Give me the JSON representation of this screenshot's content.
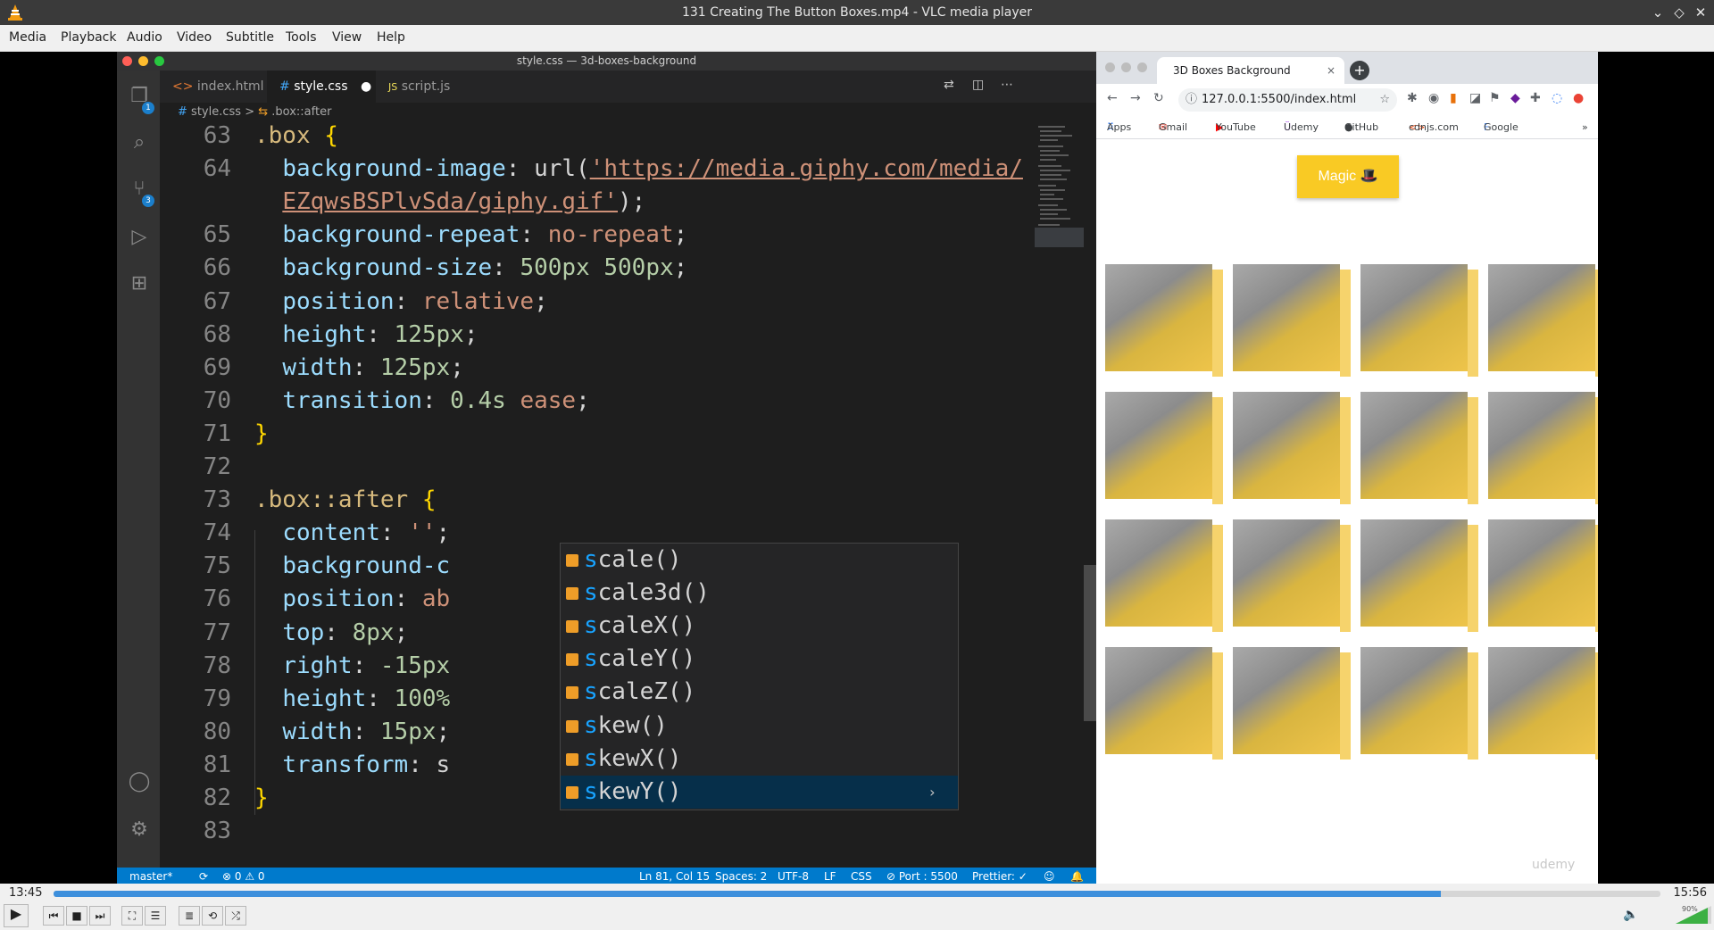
{
  "window": {
    "title": "131 Creating The Button Boxes.mp4 - VLC media player"
  },
  "menubar": [
    "Media",
    "Playback",
    "Audio",
    "Video",
    "Subtitle",
    "Tools",
    "View",
    "Help"
  ],
  "vscode": {
    "window_title": "style.css — 3d-boxes-background",
    "tabs": [
      {
        "label": "index.html",
        "icon": "html-icon",
        "active": false
      },
      {
        "label": "style.css",
        "icon": "css-icon",
        "active": true,
        "modified_dot": "●"
      },
      {
        "label": "script.js",
        "icon": "js-icon",
        "active": false
      }
    ],
    "breadcrumb": {
      "file": "style.css",
      "separator": ">",
      "symbol": ".box::after"
    },
    "activity_badges": {
      "explorer": "1",
      "scm": "3"
    },
    "lines": [
      {
        "n": "63",
        "segments": [
          {
            "t": ".box",
            "c": "sel"
          },
          {
            "t": " ",
            "c": ""
          },
          {
            "t": "{",
            "c": "brace"
          }
        ]
      },
      {
        "n": "64",
        "segments": [
          {
            "t": "  ",
            "c": ""
          },
          {
            "t": "background-image",
            "c": "prop"
          },
          {
            "t": ": url(",
            "c": ""
          },
          {
            "t": "'https://media.giphy.com/media/",
            "c": "str"
          }
        ]
      },
      {
        "n": "",
        "segments": [
          {
            "t": "  ",
            "c": ""
          },
          {
            "t": "EZqwsBSPlvSda/giphy.gif'",
            "c": "str"
          },
          {
            "t": ");",
            "c": ""
          }
        ]
      },
      {
        "n": "65",
        "segments": [
          {
            "t": "  ",
            "c": ""
          },
          {
            "t": "background-repeat",
            "c": "prop"
          },
          {
            "t": ": ",
            "c": ""
          },
          {
            "t": "no-repeat",
            "c": "val"
          },
          {
            "t": ";",
            "c": ""
          }
        ]
      },
      {
        "n": "66",
        "segments": [
          {
            "t": "  ",
            "c": ""
          },
          {
            "t": "background-size",
            "c": "prop"
          },
          {
            "t": ": ",
            "c": ""
          },
          {
            "t": "500px 500px",
            "c": "num"
          },
          {
            "t": ";",
            "c": ""
          }
        ]
      },
      {
        "n": "67",
        "segments": [
          {
            "t": "  ",
            "c": ""
          },
          {
            "t": "position",
            "c": "prop"
          },
          {
            "t": ": ",
            "c": ""
          },
          {
            "t": "relative",
            "c": "val"
          },
          {
            "t": ";",
            "c": ""
          }
        ]
      },
      {
        "n": "68",
        "segments": [
          {
            "t": "  ",
            "c": ""
          },
          {
            "t": "height",
            "c": "prop"
          },
          {
            "t": ": ",
            "c": ""
          },
          {
            "t": "125px",
            "c": "num"
          },
          {
            "t": ";",
            "c": ""
          }
        ]
      },
      {
        "n": "69",
        "segments": [
          {
            "t": "  ",
            "c": ""
          },
          {
            "t": "width",
            "c": "prop"
          },
          {
            "t": ": ",
            "c": ""
          },
          {
            "t": "125px",
            "c": "num"
          },
          {
            "t": ";",
            "c": ""
          }
        ]
      },
      {
        "n": "70",
        "segments": [
          {
            "t": "  ",
            "c": ""
          },
          {
            "t": "transition",
            "c": "prop"
          },
          {
            "t": ": ",
            "c": ""
          },
          {
            "t": "0.4s",
            "c": "num"
          },
          {
            "t": " ",
            "c": ""
          },
          {
            "t": "ease",
            "c": "val"
          },
          {
            "t": ";",
            "c": ""
          }
        ]
      },
      {
        "n": "71",
        "segments": [
          {
            "t": "}",
            "c": "brace"
          }
        ]
      },
      {
        "n": "72",
        "segments": []
      },
      {
        "n": "73",
        "segments": [
          {
            "t": ".box::after",
            "c": "sel"
          },
          {
            "t": " ",
            "c": ""
          },
          {
            "t": "{",
            "c": "brace"
          }
        ]
      },
      {
        "n": "74",
        "segments": [
          {
            "t": "  ",
            "c": ""
          },
          {
            "t": "content",
            "c": "prop"
          },
          {
            "t": ": ",
            "c": ""
          },
          {
            "t": "''",
            "c": "val"
          },
          {
            "t": ";",
            "c": ""
          }
        ]
      },
      {
        "n": "75",
        "segments": [
          {
            "t": "  ",
            "c": ""
          },
          {
            "t": "background-c",
            "c": "prop"
          }
        ]
      },
      {
        "n": "76",
        "segments": [
          {
            "t": "  ",
            "c": ""
          },
          {
            "t": "position",
            "c": "prop"
          },
          {
            "t": ": ",
            "c": ""
          },
          {
            "t": "ab",
            "c": "val"
          }
        ]
      },
      {
        "n": "77",
        "segments": [
          {
            "t": "  ",
            "c": ""
          },
          {
            "t": "top",
            "c": "prop"
          },
          {
            "t": ": ",
            "c": ""
          },
          {
            "t": "8px",
            "c": "num"
          },
          {
            "t": ";",
            "c": ""
          }
        ]
      },
      {
        "n": "78",
        "segments": [
          {
            "t": "  ",
            "c": ""
          },
          {
            "t": "right",
            "c": "prop"
          },
          {
            "t": ": ",
            "c": ""
          },
          {
            "t": "-15px",
            "c": "num"
          }
        ]
      },
      {
        "n": "79",
        "segments": [
          {
            "t": "  ",
            "c": ""
          },
          {
            "t": "height",
            "c": "prop"
          },
          {
            "t": ": ",
            "c": ""
          },
          {
            "t": "100%",
            "c": "num"
          }
        ]
      },
      {
        "n": "80",
        "segments": [
          {
            "t": "  ",
            "c": ""
          },
          {
            "t": "width",
            "c": "prop"
          },
          {
            "t": ": ",
            "c": ""
          },
          {
            "t": "15px",
            "c": "num"
          },
          {
            "t": ";",
            "c": ""
          }
        ]
      },
      {
        "n": "81",
        "segments": [
          {
            "t": "  ",
            "c": ""
          },
          {
            "t": "transform",
            "c": "prop"
          },
          {
            "t": ": s",
            "c": ""
          }
        ]
      },
      {
        "n": "82",
        "segments": [
          {
            "t": "}",
            "c": "brace"
          }
        ]
      },
      {
        "n": "83",
        "segments": []
      }
    ],
    "suggestions": [
      {
        "prefix": "s",
        "rest": "cale()"
      },
      {
        "prefix": "s",
        "rest": "cale3d()"
      },
      {
        "prefix": "s",
        "rest": "caleX()"
      },
      {
        "prefix": "s",
        "rest": "caleY()"
      },
      {
        "prefix": "s",
        "rest": "caleZ()"
      },
      {
        "prefix": "s",
        "rest": "kew()"
      },
      {
        "prefix": "s",
        "rest": "kewX()"
      },
      {
        "prefix": "s",
        "rest": "kewY()",
        "active": true,
        "more": "›"
      }
    ],
    "status": {
      "branch": "master*",
      "problems": "⊗ 0 ⚠ 0",
      "position": "Ln 81, Col 15",
      "spaces": "Spaces: 2",
      "encoding": "UTF-8",
      "eol": "LF",
      "language": "CSS",
      "port": "⊘ Port : 5500",
      "prettier": "Prettier: ✓"
    }
  },
  "browser": {
    "tab_title": "3D Boxes Background",
    "tab_close": "×",
    "new_tab": "+",
    "url": "127.0.0.1:5500/index.html",
    "bookmarks": [
      "Apps",
      "Gmail",
      "YouTube",
      "Udemy",
      "GitHub",
      "cdnjs.com",
      "Google Fonts",
      "»"
    ],
    "magic_button": "Magic 🎩",
    "box_count": 16,
    "watermark": "udemy"
  },
  "player": {
    "elapsed": "13:45",
    "total": "15:56",
    "progress": 0.8635,
    "volume_label": "90%",
    "volume": 0.9
  },
  "colors": {
    "vscode_bg": "#1e1e1e",
    "status_blue": "#007acc",
    "magic_yellow": "#f9ca24",
    "seek_blue": "#3d8fdc"
  }
}
